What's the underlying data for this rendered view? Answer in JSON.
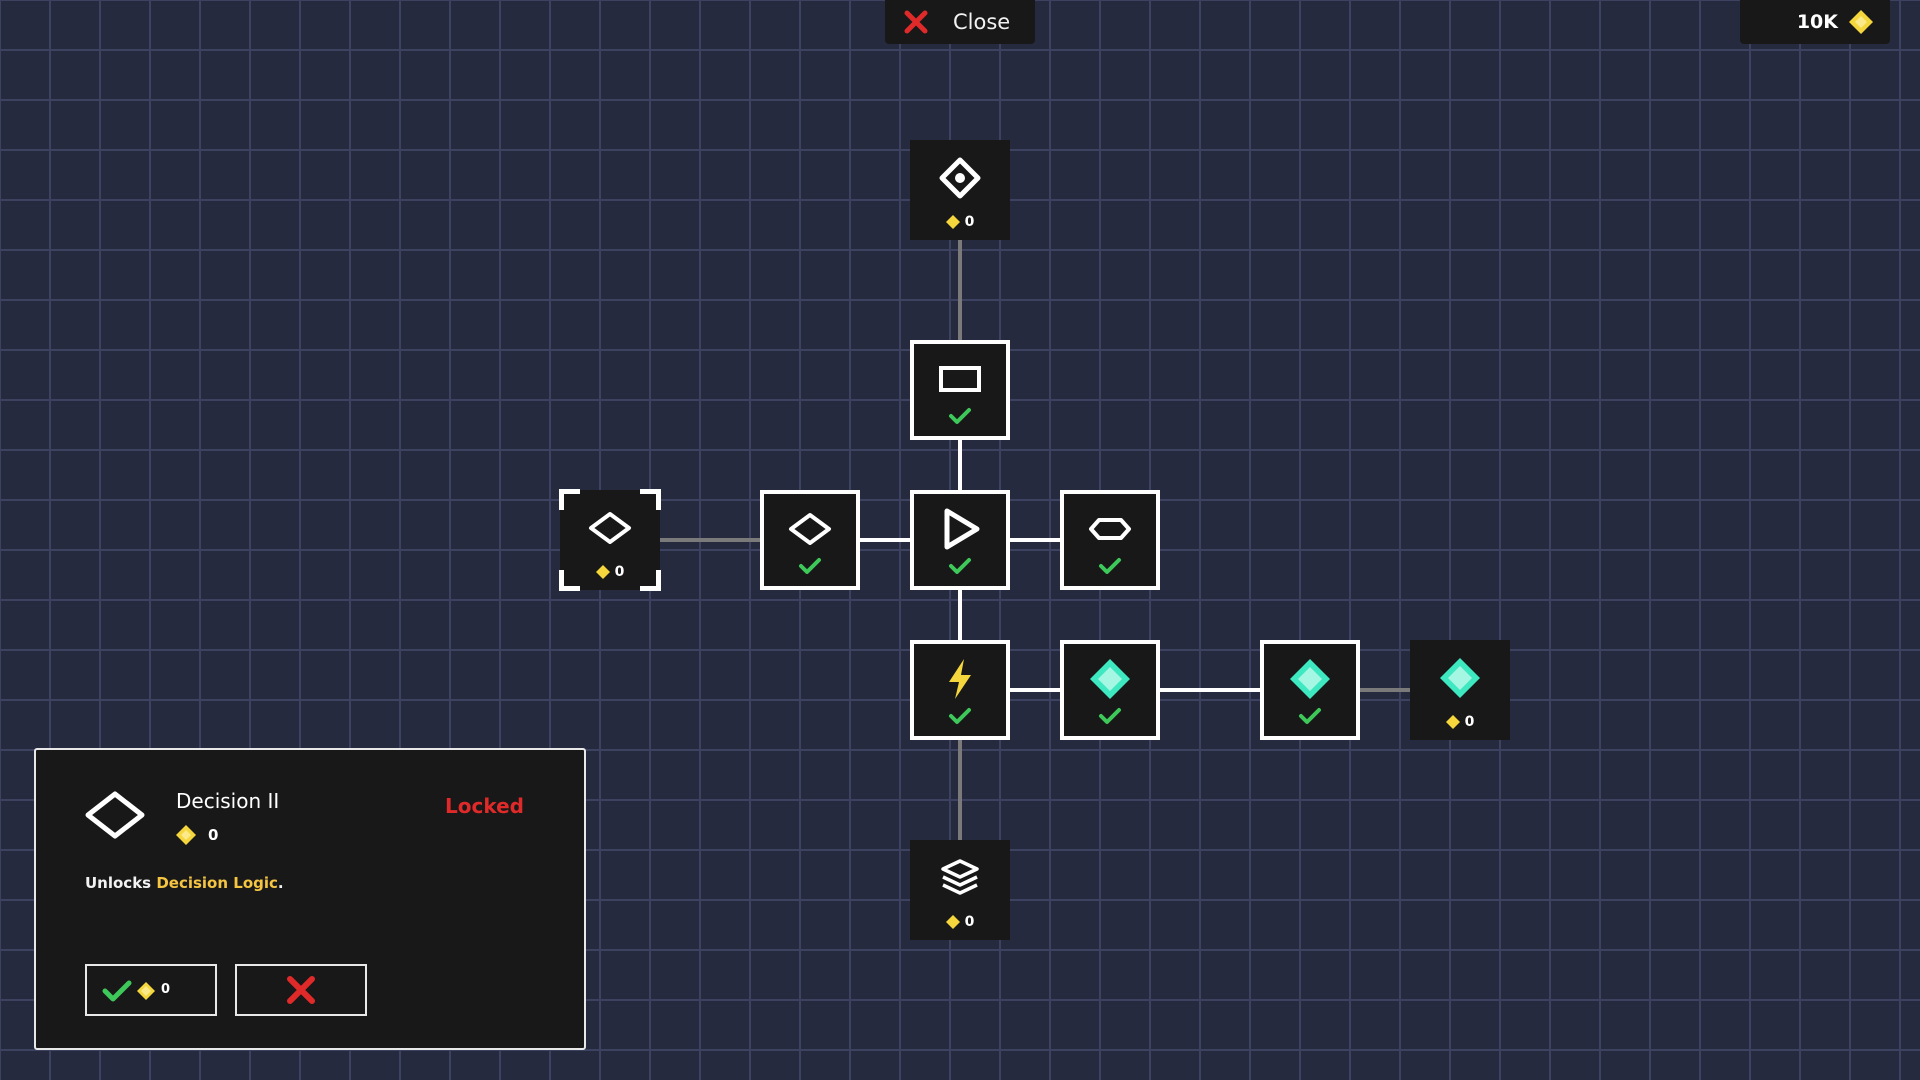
{
  "topbar": {
    "close_label": "Close",
    "currency_value": "10K"
  },
  "colors": {
    "currency": "#f5d63d",
    "check": "#3ec85a",
    "teal": "#3ee8c0",
    "lightning": "#f5d63d",
    "locked": "#e02a2a",
    "highlight": "#f5c542"
  },
  "nodes": [
    {
      "id": "target",
      "icon": "diamond-target-icon",
      "state": "locked",
      "cost": "0"
    },
    {
      "id": "rectangle",
      "icon": "rectangle-icon",
      "state": "unlocked"
    },
    {
      "id": "decision-ii",
      "icon": "diamond-outline-icon",
      "state": "locked",
      "cost": "0",
      "selected": true
    },
    {
      "id": "decision",
      "icon": "diamond-outline-icon",
      "state": "unlocked"
    },
    {
      "id": "start",
      "icon": "play-triangle-icon",
      "state": "unlocked"
    },
    {
      "id": "hexagon",
      "icon": "hexagon-icon",
      "state": "unlocked"
    },
    {
      "id": "lightning",
      "icon": "lightning-icon",
      "state": "unlocked"
    },
    {
      "id": "gem-1",
      "icon": "teal-gem-icon",
      "state": "unlocked"
    },
    {
      "id": "gem-2",
      "icon": "teal-gem-icon",
      "state": "unlocked"
    },
    {
      "id": "gem-3",
      "icon": "teal-gem-icon",
      "state": "locked",
      "cost": "0"
    },
    {
      "id": "stack",
      "icon": "layers-stack-icon",
      "state": "locked",
      "cost": "0"
    }
  ],
  "panel": {
    "icon": "diamond-outline-icon",
    "title": "Decision II",
    "cost": "0",
    "status": "Locked",
    "desc_prefix": "Unlocks ",
    "desc_highlight": "Decision Logic",
    "desc_suffix": ".",
    "confirm_cost": "0"
  }
}
